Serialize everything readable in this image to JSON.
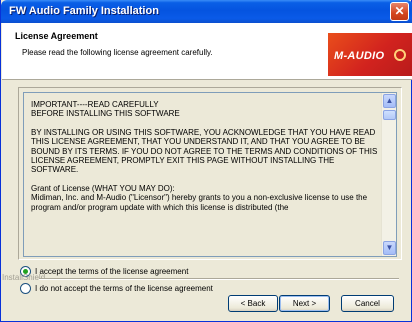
{
  "window": {
    "title": "FW Audio Family Installation",
    "close_symbol": "✕"
  },
  "header": {
    "title": "License Agreement",
    "subtitle": "Please read the following license agreement carefully.",
    "logo_text": "M-AUDIO"
  },
  "license": {
    "paragraphs": [
      "IMPORTANT----READ CAREFULLY\nBEFORE INSTALLING THIS SOFTWARE",
      "BY INSTALLING OR USING THIS SOFTWARE, YOU ACKNOWLEDGE THAT YOU HAVE READ THIS LICENSE AGREEMENT, THAT YOU UNDERSTAND IT, AND THAT YOU AGREE TO BE BOUND BY ITS TERMS.  IF YOU DO NOT AGREE TO THE TERMS AND CONDITIONS OF THIS LICENSE AGREEMENT, PROMPTLY EXIT THIS PAGE WITHOUT INSTALLING THE SOFTWARE.",
      "Grant of License  (WHAT YOU MAY DO):\nMidiman, Inc. and M-Audio  (\"Licensor\") hereby grants to you a non-exclusive license to use the program and/or program update with which this license is distributed (the"
    ],
    "scroll_up": "▲",
    "scroll_down": "▼"
  },
  "options": {
    "accept": "I accept the terms of the license agreement",
    "decline": "I do not accept the terms of the license agreement",
    "selected": "accept"
  },
  "footer": {
    "brand": "InstallShield",
    "back": "< Back",
    "next": "Next >",
    "cancel": "Cancel"
  }
}
